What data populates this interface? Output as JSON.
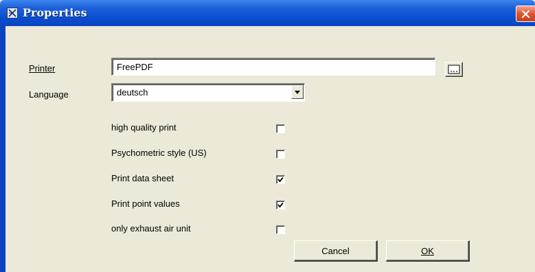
{
  "window": {
    "title": "Properties",
    "app_icon": "app-document-icon",
    "close_icon": "close-icon"
  },
  "form": {
    "printer_label": "Printer",
    "printer_value": "FreePDF",
    "browse_icon": "browse-icon",
    "language_label": "Language",
    "language_value": "deutsch",
    "options": [
      {
        "label": "high quality print",
        "checked": false
      },
      {
        "label": "Psychometric style (US)",
        "checked": false
      },
      {
        "label": "Print data sheet",
        "checked": true
      },
      {
        "label": "Print point values",
        "checked": true
      },
      {
        "label": "only exhaust air unit",
        "checked": false
      }
    ]
  },
  "buttons": {
    "cancel_label": "Cancel",
    "ok_label": "OK"
  },
  "colors": {
    "titlebar": "#0a4ed0",
    "dialog_bg": "#ece9d8",
    "close_button": "#e0532f"
  }
}
